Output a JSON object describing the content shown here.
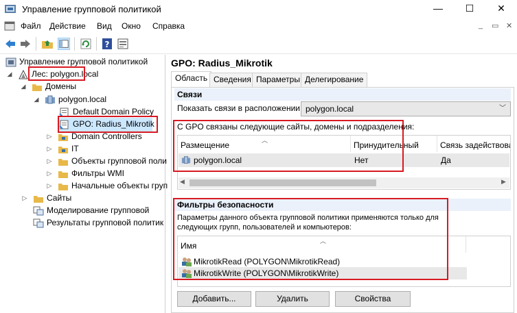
{
  "window": {
    "title": "Управление групповой политикой",
    "minimize_glyph": "—",
    "maximize_glyph": "☐",
    "close_glyph": "✕"
  },
  "menu": {
    "items": [
      "Файл",
      "Действие",
      "Вид",
      "Окно",
      "Справка"
    ],
    "mdi_controls": [
      "_",
      "▭",
      "✕"
    ]
  },
  "toolbar": {
    "icons": [
      "back-arrow-icon",
      "forward-arrow-icon",
      "folder-up-icon",
      "console-tree-icon",
      "refresh-icon",
      "help-icon",
      "properties-icon"
    ]
  },
  "tree": {
    "root": "Управление групповой политикой",
    "forest": "Лес: polygon.local",
    "domains": "Домены",
    "domain": "polygon.local",
    "default_policy": "Default Domain Policy",
    "selected_gpo": "GPO: Radius_Mikrotik",
    "dc": "Domain Controllers",
    "it": "IT",
    "gpo_objects": "Объекты групповой поли",
    "wmi": "Фильтры WMI",
    "starter": "Начальные объекты груп",
    "sites": "Сайты",
    "modeling": "Моделирование групповой",
    "results": "Результаты групповой политик"
  },
  "right": {
    "title": "GPO: Radius_Mikrotik",
    "tabs": [
      "Область",
      "Сведения",
      "Параметры",
      "Делегирование"
    ],
    "active_tab": "Область",
    "links": {
      "header": "Связи",
      "show_label": "Показать связи в расположении:",
      "location_value": "polygon.local",
      "description": "С GPO связаны следующие сайты, домены и подразделения:",
      "columns": [
        "Размещение",
        "Принудительный",
        "Связь задействова"
      ],
      "rows": [
        {
          "location": "polygon.local",
          "enforced": "Нет",
          "enabled": "Да"
        }
      ]
    },
    "security": {
      "header": "Фильтры безопасности",
      "description_line1": "Параметры данного объекта групповой политики применяются только для",
      "description_line2": "следующих групп, пользователей и компьютеров:",
      "column": "Имя",
      "rows": [
        "MikrotikRead (POLYGON\\MikrotikRead)",
        "MikrotikWrite (POLYGON\\MikrotikWrite)"
      ],
      "buttons": [
        "Добавить...",
        "Удалить",
        "Свойства"
      ]
    }
  },
  "colors": {
    "highlight_red": "#d71920",
    "selection": "#cce8ff",
    "section_header_bg": "#eaf1fb"
  }
}
